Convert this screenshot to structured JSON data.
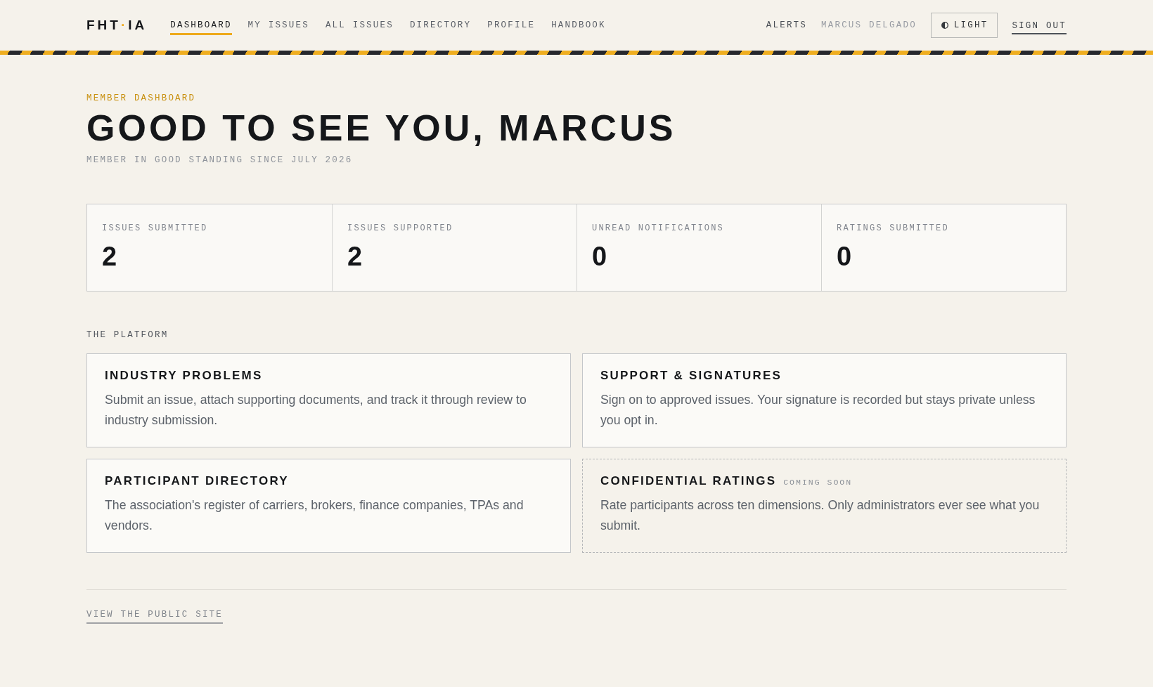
{
  "header": {
    "logo": {
      "start": "FHT",
      "dot": "·",
      "end": "IA"
    },
    "nav": [
      {
        "label": "DASHBOARD",
        "selected": true
      },
      {
        "label": "MY ISSUES",
        "selected": false
      },
      {
        "label": "ALL ISSUES",
        "selected": false
      },
      {
        "label": "DIRECTORY",
        "selected": false
      },
      {
        "label": "PROFILE",
        "selected": false
      },
      {
        "label": "HANDBOOK",
        "selected": false
      }
    ],
    "alerts": "ALERTS",
    "user_name": "MARCUS DELGADO",
    "theme_button": "LIGHT",
    "sign_out": "SIGN OUT"
  },
  "intro": {
    "eyebrow": "MEMBER DASHBOARD",
    "title": "GOOD TO SEE YOU, MARCUS",
    "subtitle": "MEMBER IN GOOD STANDING SINCE JULY 2026"
  },
  "stats": [
    {
      "label": "ISSUES SUBMITTED",
      "value": "2"
    },
    {
      "label": "ISSUES SUPPORTED",
      "value": "2"
    },
    {
      "label": "UNREAD NOTIFICATIONS",
      "value": "0"
    },
    {
      "label": "RATINGS SUBMITTED",
      "value": "0"
    }
  ],
  "platform": {
    "heading": "THE PLATFORM",
    "cards": [
      {
        "kind": "live",
        "title": "INDUSTRY PROBLEMS",
        "description": "Submit an issue, attach supporting documents, and track it through review to industry submission."
      },
      {
        "kind": "live",
        "title": "SUPPORT & SIGNATURES",
        "description": "Sign on to approved issues. Your signature is recorded but stays private unless you opt in."
      },
      {
        "kind": "live",
        "title": "PARTICIPANT DIRECTORY",
        "description": "The association's register of carriers, brokers, finance companies, TPAs and vendors."
      },
      {
        "kind": "upcoming",
        "title": "CONFIDENTIAL RATINGS",
        "badge": "COMING SOON",
        "description": "Rate participants across ten dimensions. Only administrators ever see what you submit."
      }
    ]
  },
  "footer": {
    "link": "VIEW THE PUBLIC SITE"
  }
}
